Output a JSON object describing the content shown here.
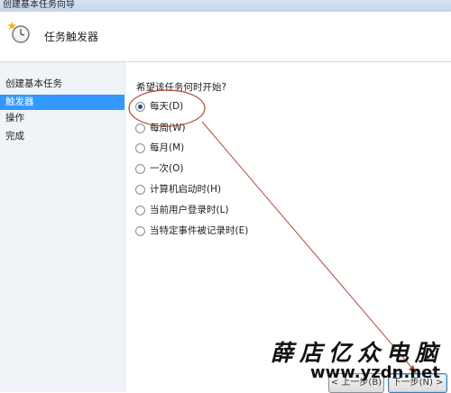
{
  "window": {
    "title": "创建基本任务向导"
  },
  "header": {
    "title": "任务触发器"
  },
  "sidebar": {
    "items": [
      {
        "label": "创建基本任务",
        "active": false
      },
      {
        "label": "触发器",
        "active": true
      },
      {
        "label": "操作",
        "active": false
      },
      {
        "label": "完成",
        "active": false
      }
    ]
  },
  "main": {
    "question": "希望该任务何时开始?",
    "options": [
      {
        "label": "每天(D)",
        "checked": true
      },
      {
        "label": "每周(W)",
        "checked": false
      },
      {
        "label": "每月(M)",
        "checked": false
      },
      {
        "label": "一次(O)",
        "checked": false
      },
      {
        "label": "计算机启动时(H)",
        "checked": false
      },
      {
        "label": "当前用户登录时(L)",
        "checked": false
      },
      {
        "label": "当特定事件被记录时(E)",
        "checked": false
      }
    ]
  },
  "footer": {
    "back_label": "< 上一步(B)",
    "next_label": "下一步(N) >"
  },
  "watermark": {
    "text": "薛店亿众电脑",
    "url": "www.yzdn.net"
  },
  "colors": {
    "selection": "#3399ff",
    "annotation": "#b24a3a"
  }
}
